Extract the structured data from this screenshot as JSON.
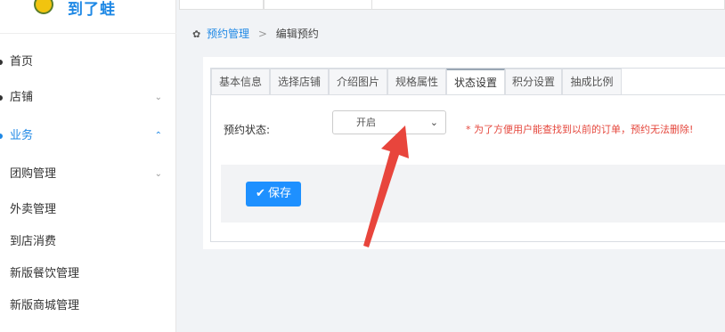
{
  "brand": {
    "name": "到了蛙"
  },
  "sidebar": {
    "items": [
      {
        "label": "首页",
        "chevron": ""
      },
      {
        "label": "店铺",
        "chevron": "⌄"
      },
      {
        "label": "业务",
        "chevron": "⌃"
      },
      {
        "label": "团购管理",
        "chevron": "⌄"
      },
      {
        "label": "外卖管理",
        "chevron": ""
      },
      {
        "label": "到店消费",
        "chevron": ""
      },
      {
        "label": "新版餐饮管理",
        "chevron": ""
      },
      {
        "label": "新版商城管理",
        "chevron": ""
      }
    ]
  },
  "breadcrumb": {
    "parent": "预约管理",
    "separator": ">",
    "current": "编辑预约"
  },
  "tabs": [
    {
      "label": "基本信息"
    },
    {
      "label": "选择店铺"
    },
    {
      "label": "介绍图片"
    },
    {
      "label": "规格属性"
    },
    {
      "label": "状态设置"
    },
    {
      "label": "积分设置"
    },
    {
      "label": "抽成比例"
    }
  ],
  "form": {
    "status_label": "预约状态:",
    "status_value": "开启",
    "hint": "* 为了方便用户能查找到以前的订单，预约无法删除!"
  },
  "actions": {
    "save_label": "保存"
  },
  "colors": {
    "accent": "#1e88e5",
    "button": "#1e90ff",
    "hint": "#e5473d",
    "arrow": "#e8453c"
  },
  "icons": {
    "home": "gear-icon",
    "save": "check-icon",
    "select": "chevron-down-icon",
    "annotation": "red-arrow"
  }
}
